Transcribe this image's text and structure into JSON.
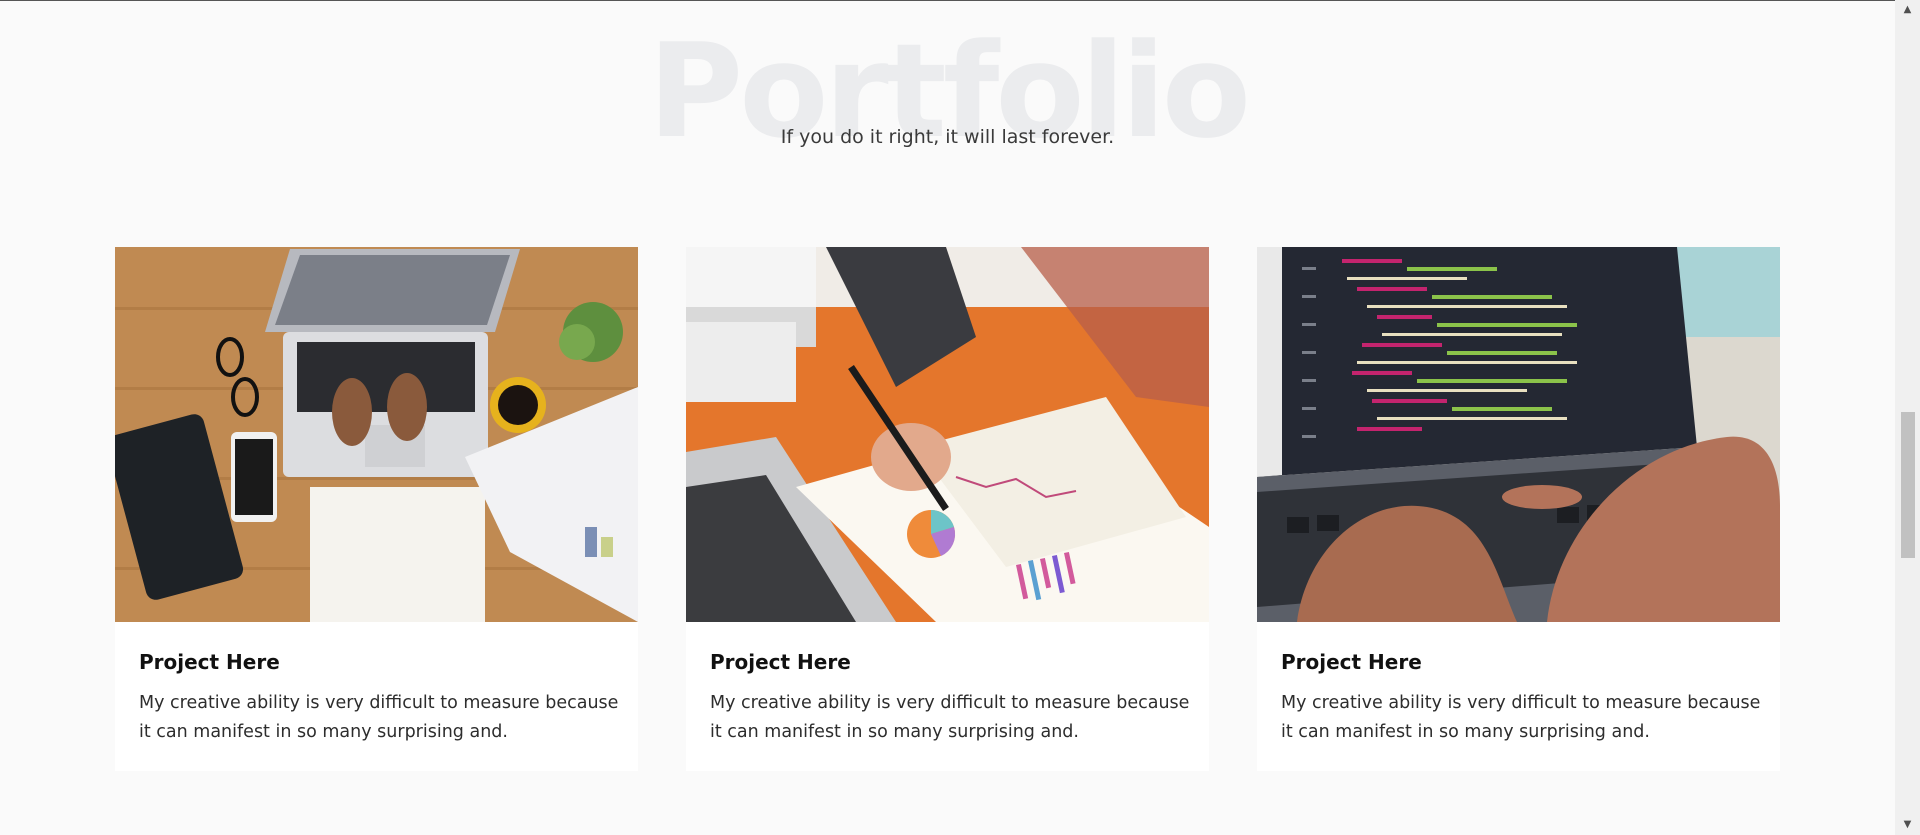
{
  "section": {
    "background_title": "Portfolio",
    "subtitle": "If you do it right, it will last forever."
  },
  "cards": [
    {
      "title": "Project Here",
      "description": "My creative ability is very difficult to measure because it can manifest in so many surprising and.",
      "image": "laptop-desk-workspace"
    },
    {
      "title": "Project Here",
      "description": "My creative ability is very difficult to measure because it can manifest in so many surprising and.",
      "image": "analytics-charts-paperwork"
    },
    {
      "title": "Project Here",
      "description": "My creative ability is very difficult to measure because it can manifest in so many surprising and.",
      "image": "code-editor-laptop"
    }
  ],
  "scrollbar": {
    "position_fraction": 0.55
  },
  "colors": {
    "background": "#fafafa",
    "card": "#ffffff",
    "title_watermark": "#ebecee"
  }
}
